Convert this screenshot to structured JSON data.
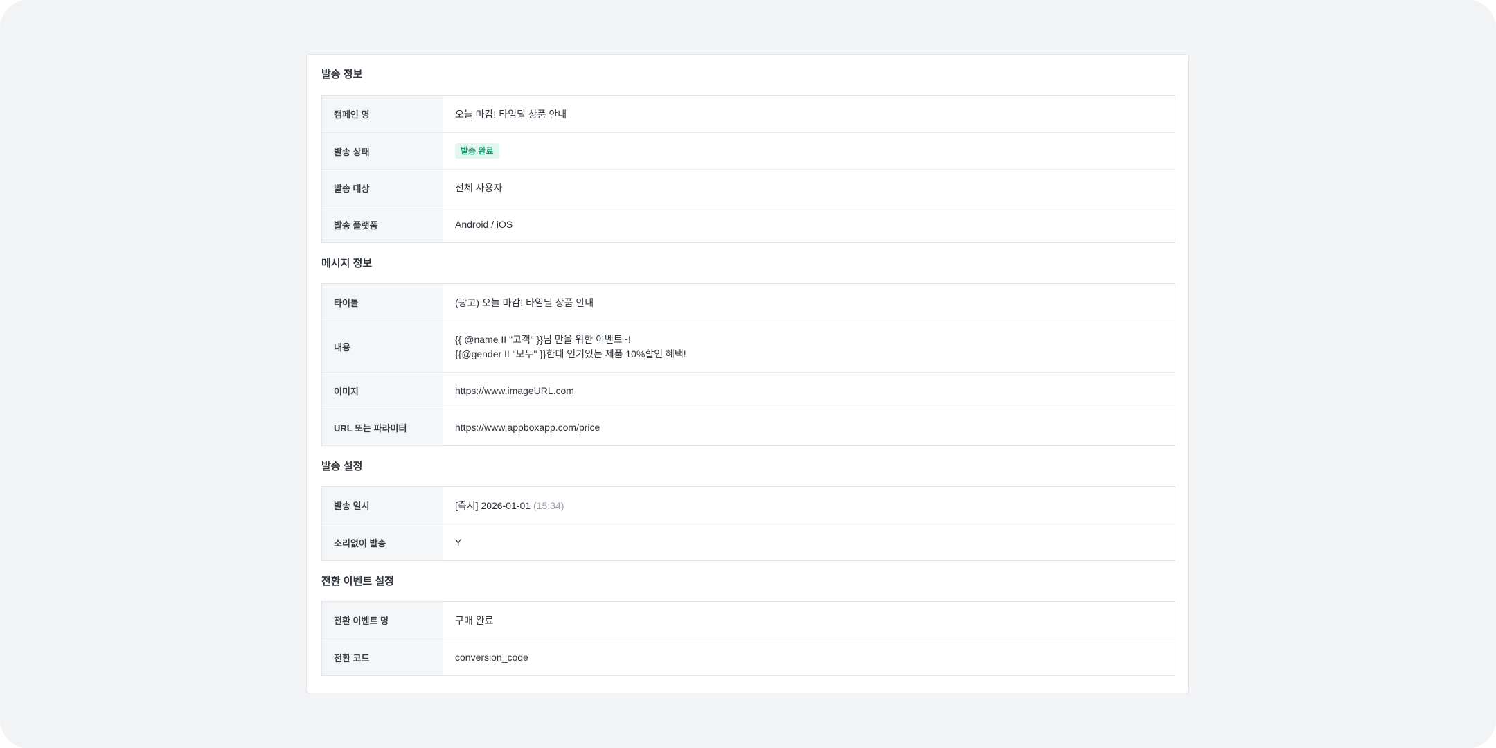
{
  "sections": [
    {
      "title": "발송 정보",
      "rows": [
        {
          "label": "캠페인 명",
          "value": "오늘 마감! 타임딜 상품 안내"
        },
        {
          "label": "발송 상태",
          "badge": "발송 완료",
          "badge_color": "#1f9b6e",
          "badge_bg": "#dff7ee"
        },
        {
          "label": "발송 대상",
          "value": "전체 사용자"
        },
        {
          "label": "발송 플랫폼",
          "value": "Android / iOS"
        }
      ]
    },
    {
      "title": "메시지 정보",
      "rows": [
        {
          "label": "타이틀",
          "value": "(광고) 오늘 마감! 타임딜 상품 안내"
        },
        {
          "label": "내용",
          "lines": [
            "{{ @name II \"고객\" }}님 만을 위한 이벤트~!",
            "{{@gender II \"모두\" }}한테 인기있는 제품 10%할인 혜택!"
          ]
        },
        {
          "label": "이미지",
          "value": "https://www.imageURL.com"
        },
        {
          "label": "URL 또는 파라미터",
          "value": "https://www.appboxapp.com/price"
        }
      ]
    },
    {
      "title": "발송 설정",
      "rows": [
        {
          "label": "발송 일시",
          "value": "[즉시] 2026-01-01",
          "value_muted": "(15:34)"
        },
        {
          "label": "소리없이 발송",
          "value": "Y"
        }
      ]
    },
    {
      "title": "전환 이벤트 설정",
      "rows": [
        {
          "label": "전환 이벤트 명",
          "value": "구매 완료"
        },
        {
          "label": "전환 코드",
          "value": "conversion_code"
        }
      ]
    }
  ]
}
